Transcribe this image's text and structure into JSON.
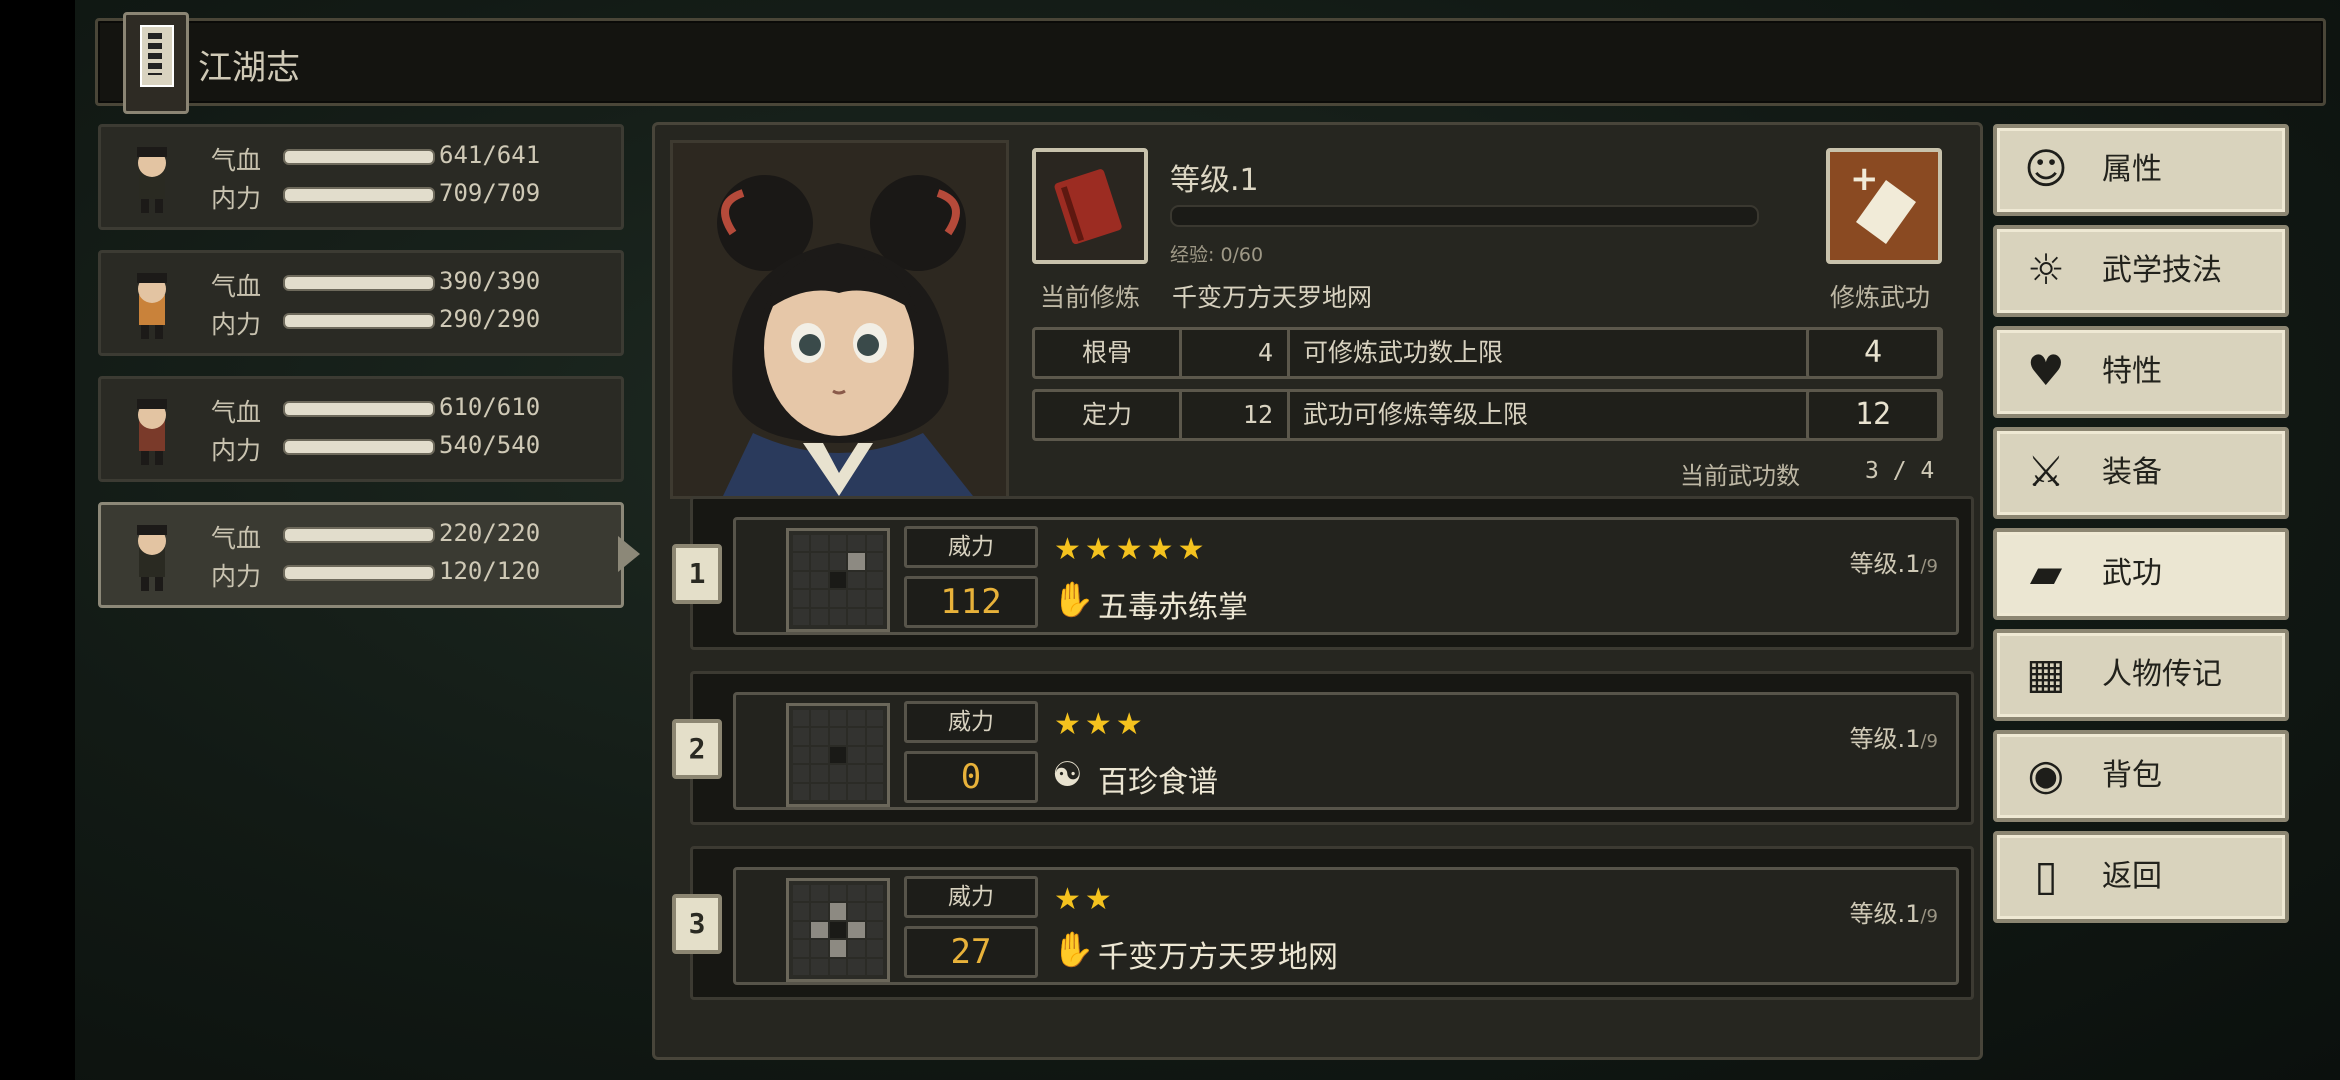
{
  "header": {
    "title": "江湖志"
  },
  "party": [
    {
      "hp_label": "气血",
      "hp": "641/641",
      "mp_label": "内力",
      "mp": "709/709",
      "hp_fill": 1.0,
      "mp_fill": 1.0
    },
    {
      "hp_label": "气血",
      "hp": "390/390",
      "mp_label": "内力",
      "mp": "290/290",
      "hp_fill": 1.0,
      "mp_fill": 1.0
    },
    {
      "hp_label": "气血",
      "hp": "610/610",
      "mp_label": "内力",
      "mp": "540/540",
      "hp_fill": 1.0,
      "mp_fill": 1.0
    },
    {
      "hp_label": "气血",
      "hp": "220/220",
      "mp_label": "内力",
      "mp": "120/120",
      "hp_fill": 1.0,
      "mp_fill": 1.0
    }
  ],
  "character": {
    "level": "等级.1",
    "exp": "经验: 0/60",
    "exp_fill": 0.0,
    "current_label": "当前修炼",
    "current_skill": "千变万方天罗地网",
    "practice_label": "修炼武功",
    "stats": [
      {
        "name": "根骨",
        "value": "4",
        "desc": "可修炼武功数上限",
        "cap": "4"
      },
      {
        "name": "定力",
        "value": "12",
        "desc": "武功可修炼等级上限",
        "cap": "12"
      }
    ],
    "skill_count_label": "当前武功数",
    "skill_count": "3 / 4"
  },
  "skills": [
    {
      "num": "1",
      "power_label": "威力",
      "power": "112",
      "stars": "★★★★★",
      "icon": "palm-icon",
      "icon_glyph": "✋",
      "name": "五毒赤练掌",
      "level": "等级.1",
      "max": "/9",
      "grid": [
        0,
        0,
        0,
        0,
        0,
        0,
        0,
        0,
        2,
        0,
        0,
        0,
        1,
        0,
        0,
        0,
        0,
        0,
        0,
        0,
        0,
        0,
        0,
        0,
        0
      ]
    },
    {
      "num": "2",
      "power_label": "威力",
      "power": "0",
      "stars": "★★★",
      "icon": "yin-yang-icon",
      "icon_glyph": "☯",
      "name": "百珍食谱",
      "level": "等级.1",
      "max": "/9",
      "grid": [
        0,
        0,
        0,
        0,
        0,
        0,
        0,
        0,
        0,
        0,
        0,
        0,
        1,
        0,
        0,
        0,
        0,
        0,
        0,
        0,
        0,
        0,
        0,
        0,
        0
      ]
    },
    {
      "num": "3",
      "power_label": "威力",
      "power": "27",
      "stars": "★★",
      "icon": "palm-icon",
      "icon_glyph": "✋",
      "name": "千变万方天罗地网",
      "level": "等级.1",
      "max": "/9",
      "grid": [
        0,
        0,
        0,
        0,
        0,
        0,
        0,
        2,
        0,
        0,
        0,
        2,
        1,
        2,
        0,
        0,
        0,
        2,
        0,
        0,
        0,
        0,
        0,
        0,
        0
      ]
    }
  ],
  "menu": [
    {
      "label": "属性",
      "icon": "person-icon",
      "glyph": "☺"
    },
    {
      "label": "武学技法",
      "icon": "insight-icon",
      "glyph": "☼"
    },
    {
      "label": "特性",
      "icon": "trait-icon",
      "glyph": "♥"
    },
    {
      "label": "装备",
      "icon": "sword-icon",
      "glyph": "⚔"
    },
    {
      "label": "武功",
      "icon": "manual-icon",
      "glyph": "▰"
    },
    {
      "label": "人物传记",
      "icon": "scroll-icon",
      "glyph": "▦"
    },
    {
      "label": "背包",
      "icon": "bag-icon",
      "glyph": "◉"
    },
    {
      "label": "返回",
      "icon": "door-icon",
      "glyph": "▯"
    }
  ],
  "colors": {
    "accent_gold": "#e8b23a",
    "star": "#f4c21e",
    "menu_bg": "#d9d3bd"
  }
}
